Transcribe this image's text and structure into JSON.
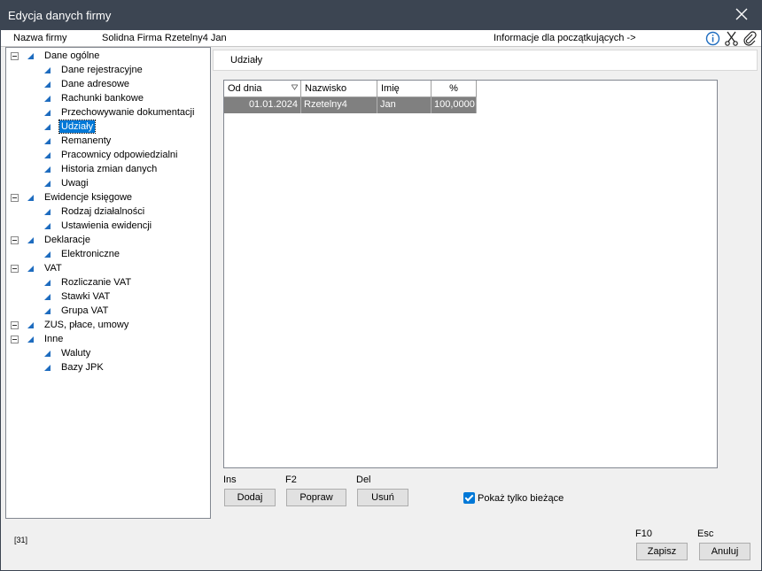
{
  "window": {
    "title": "Edycja danych firmy"
  },
  "infobar": {
    "company_label": "Nazwa firmy",
    "company_name": "Solidna Firma Rzetelny4 Jan",
    "beginner_info": "Informacje dla początkujących ->"
  },
  "tree": {
    "groups": [
      {
        "label": "Dane ogólne",
        "items": [
          "Dane rejestracyjne",
          "Dane adresowe",
          "Rachunki bankowe",
          "Przechowywanie dokumentacji",
          "Udziały",
          "Remanenty",
          "Pracownicy odpowiedzialni",
          "Historia zmian danych",
          "Uwagi"
        ]
      },
      {
        "label": "Ewidencje księgowe",
        "items": [
          "Rodzaj działalności",
          "Ustawienia ewidencji"
        ]
      },
      {
        "label": "Deklaracje",
        "items": [
          "Elektroniczne"
        ]
      },
      {
        "label": "VAT",
        "items": [
          "Rozliczanie VAT",
          "Stawki VAT",
          "Grupa VAT"
        ]
      },
      {
        "label": "ZUS, płace, umowy",
        "items": []
      },
      {
        "label": "Inne",
        "items": [
          "Waluty",
          "Bazy JPK"
        ]
      }
    ],
    "selected": "Udziały"
  },
  "panel": {
    "title": "Udziały"
  },
  "grid": {
    "columns": [
      "Od dnia",
      "Nazwisko",
      "Imię",
      "%"
    ],
    "rows": [
      {
        "date": "01.01.2024",
        "surname": "Rzetelny4",
        "name": "Jan",
        "percent": "100,0000"
      }
    ]
  },
  "actions": {
    "add_key": "Ins",
    "add_label": "Dodaj",
    "edit_key": "F2",
    "edit_label": "Popraw",
    "delete_key": "Del",
    "delete_label": "Usuń",
    "current_only_label": "Pokaż tylko bieżące",
    "current_only_checked": true
  },
  "footer": {
    "status_code": "[31]",
    "save_key": "F10",
    "save_label": "Zapisz",
    "cancel_key": "Esc",
    "cancel_label": "Anuluj"
  },
  "colors": {
    "titlebar": "#3c4552",
    "selection": "#0078d7",
    "tree_triangle": "#1e6cbf",
    "grid_row": "#808080"
  },
  "icons": [
    "close-icon",
    "info-icon",
    "scissors-icon",
    "paperclip-icon",
    "expander-minus-icon",
    "tree-node-icon",
    "sort-filter-icon",
    "checkbox-checked-icon"
  ]
}
